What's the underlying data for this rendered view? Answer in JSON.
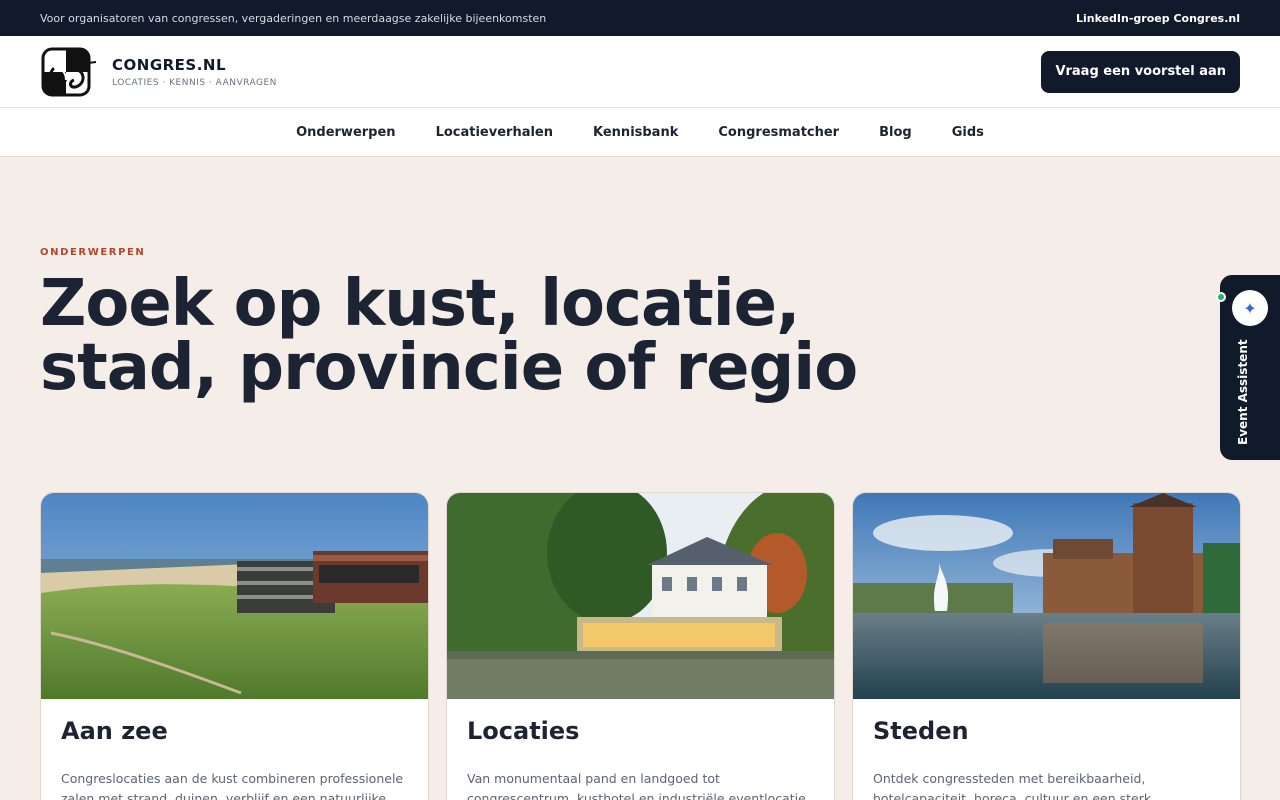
{
  "topbar": {
    "tagline": "Voor organisatoren van congressen, vergaderingen en meerdaagse zakelijke bijeenkomsten",
    "link": "LinkedIn-groep Congres.nl"
  },
  "header": {
    "brand_name": "CONGRES.NL",
    "brand_tagline": "LOCATIES · KENNIS · AANVRAGEN",
    "cta_label": "Vraag een voorstel aan"
  },
  "nav": {
    "items": [
      "Onderwerpen",
      "Locatieverhalen",
      "Kennisbank",
      "Congresmatcher",
      "Blog",
      "Gids"
    ]
  },
  "hero": {
    "eyebrow": "ONDERWERPEN",
    "title": "Zoek op kust, locatie, stad, provincie of regio"
  },
  "cards": [
    {
      "title": "Aan zee",
      "text": "Congreslocaties aan de kust combineren professionele zalen met strand, duinen, verblijf en een natuurlijke"
    },
    {
      "title": "Locaties",
      "text": "Van monumentaal pand en landgoed tot congrescentrum, kusthotel en industriële eventlocatie"
    },
    {
      "title": "Steden",
      "text": "Ontdek congressteden met bereikbaarheid, hotelcapaciteit, horeca, cultuur en een sterk"
    }
  ],
  "assistant": {
    "label": "Event Assistent",
    "icon": "sparkle-icon"
  },
  "colors": {
    "dark": "#111a2a",
    "accent": "#b5452d",
    "background": "#f5ede7"
  }
}
